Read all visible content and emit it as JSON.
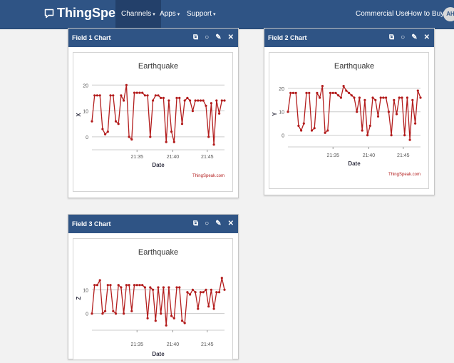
{
  "navbar": {
    "brand": "ThingSpeak",
    "trademark": "™",
    "channels_label": "Channels",
    "apps_label": "Apps",
    "support_label": "Support",
    "commercial_label": "Commercial Use",
    "howtobuy_label": "How to Buy",
    "avatar_initials": "AH"
  },
  "panels": [
    {
      "title": "Field 1 Chart"
    },
    {
      "title": "Field 2 Chart"
    },
    {
      "title": "Field 3 Chart"
    }
  ],
  "colors": {
    "navbar": "#2f5485",
    "line": "#b31d1d"
  },
  "chart_data": [
    {
      "type": "line",
      "title": "Earthquake",
      "xlabel": "Date",
      "ylabel": "X",
      "credit": "ThingSpeak.com",
      "yticks": [
        0,
        10,
        20
      ],
      "ylim": [
        -5,
        22
      ],
      "xticks": [
        "21:35",
        "21:40",
        "21:45"
      ],
      "x_tick_positions": [
        34,
        61,
        87
      ],
      "xlim": [
        0,
        100
      ],
      "grid": true,
      "x": [
        0,
        2,
        4,
        6,
        8,
        10,
        12,
        14,
        16,
        18,
        20,
        22,
        24,
        26,
        28,
        30,
        32,
        34,
        36,
        38,
        40,
        42,
        44,
        46,
        48,
        50,
        52,
        54,
        56,
        58,
        60,
        62,
        64,
        66,
        68,
        70,
        72,
        74,
        76,
        78,
        80,
        82,
        84,
        86,
        88,
        90,
        92,
        94,
        96,
        98,
        100
      ],
      "values": [
        6,
        16,
        16,
        16,
        3,
        1,
        2,
        16,
        16,
        6,
        5,
        16,
        14,
        20,
        0,
        -1,
        17,
        17,
        17,
        17,
        16,
        16,
        0,
        14,
        16,
        16,
        15,
        15,
        -2,
        14,
        2,
        -2,
        15,
        15,
        5,
        14,
        15,
        14,
        10,
        14,
        14,
        14,
        14,
        12,
        0,
        13,
        -3,
        14,
        9,
        14,
        14
      ]
    },
    {
      "type": "line",
      "title": "Earthquake",
      "xlabel": "Date",
      "ylabel": "Y",
      "credit": "ThingSpeak.com",
      "yticks": [
        0,
        10,
        20
      ],
      "ylim": [
        -5,
        23
      ],
      "xticks": [
        "21:35",
        "21:40",
        "21:45"
      ],
      "x_tick_positions": [
        34,
        61,
        87
      ],
      "xlim": [
        0,
        100
      ],
      "grid": true,
      "x": [
        0,
        2,
        4,
        6,
        8,
        10,
        12,
        14,
        16,
        18,
        20,
        22,
        24,
        26,
        28,
        30,
        32,
        34,
        36,
        38,
        40,
        42,
        44,
        46,
        48,
        50,
        52,
        54,
        56,
        58,
        60,
        62,
        64,
        66,
        68,
        70,
        72,
        74,
        76,
        78,
        80,
        82,
        84,
        86,
        88,
        90,
        92,
        94,
        96,
        98,
        100
      ],
      "values": [
        10,
        18,
        18,
        18,
        4,
        2,
        5,
        18,
        18,
        2,
        3,
        18,
        16,
        21,
        1,
        2,
        18,
        18,
        18,
        17,
        16,
        21,
        19,
        18,
        17,
        16,
        10,
        16,
        2,
        15,
        0,
        4,
        16,
        15,
        8,
        16,
        16,
        16,
        10,
        0,
        15,
        9,
        16,
        16,
        0,
        16,
        -2,
        15,
        5,
        19,
        16
      ]
    },
    {
      "type": "line",
      "title": "Earthquake",
      "xlabel": "Date",
      "ylabel": "Z",
      "credit": "",
      "yticks": [
        0,
        10
      ],
      "ylim": [
        -7,
        20
      ],
      "xticks": [
        "21:35",
        "21:40",
        "21:45"
      ],
      "x_tick_positions": [
        34,
        61,
        87
      ],
      "xlim": [
        0,
        100
      ],
      "grid": true,
      "x": [
        0,
        2,
        4,
        6,
        8,
        10,
        12,
        14,
        16,
        18,
        20,
        22,
        24,
        26,
        28,
        30,
        32,
        34,
        36,
        38,
        40,
        42,
        44,
        46,
        48,
        50,
        52,
        54,
        56,
        58,
        60,
        62,
        64,
        66,
        68,
        70,
        72,
        74,
        76,
        78,
        80,
        82,
        84,
        86,
        88,
        90,
        92,
        94,
        96,
        98,
        100
      ],
      "values": [
        0,
        12,
        12,
        14,
        0,
        1,
        12,
        12,
        1,
        0,
        12,
        11,
        0,
        12,
        12,
        1,
        12,
        12,
        12,
        12,
        11,
        -2,
        11,
        10,
        -3,
        11,
        0,
        11,
        -5,
        11,
        -1,
        -2,
        11,
        11,
        -3,
        -4,
        9,
        8,
        10,
        9,
        2,
        9,
        9,
        10,
        3,
        10,
        2,
        9,
        9,
        15,
        10
      ]
    }
  ]
}
